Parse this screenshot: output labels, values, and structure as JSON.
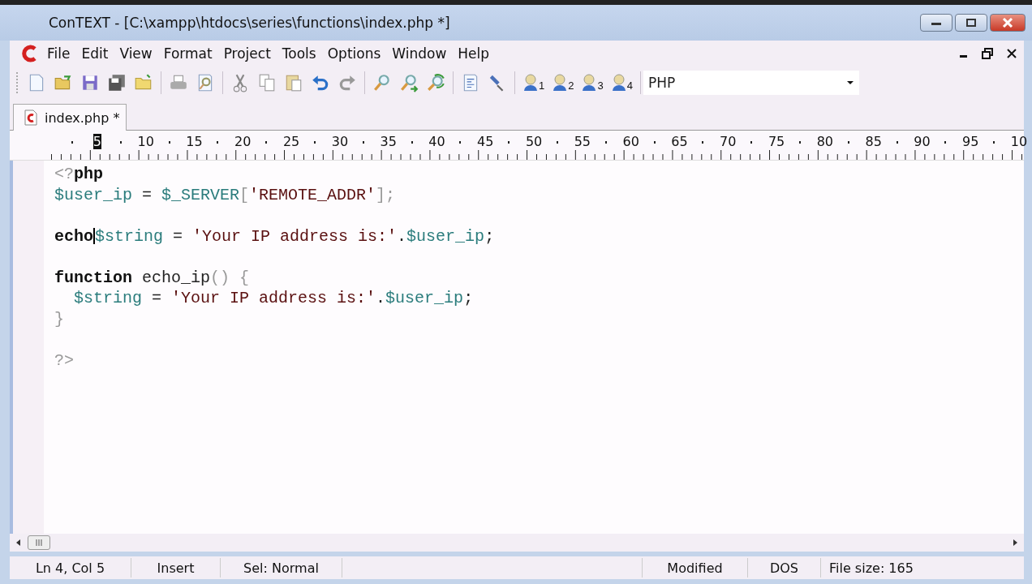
{
  "window": {
    "title": "ConTEXT - [C:\\xampp\\htdocs\\series\\functions\\index.php *]"
  },
  "menu": [
    "File",
    "Edit",
    "View",
    "Format",
    "Project",
    "Tools",
    "Options",
    "Window",
    "Help"
  ],
  "toolbar": {
    "user_slots": [
      "1",
      "2",
      "3",
      "4"
    ],
    "highlighter": "PHP"
  },
  "tabs": [
    {
      "label": "index.php *",
      "selected": true
    }
  ],
  "ruler": [
    {
      "label": "5",
      "selected": true
    },
    {
      "label": "10",
      "selected": false
    },
    {
      "label": "15",
      "selected": false
    },
    {
      "label": "20",
      "selected": false
    },
    {
      "label": "25",
      "selected": false
    },
    {
      "label": "30",
      "selected": false
    },
    {
      "label": "35",
      "selected": false
    },
    {
      "label": "40",
      "selected": false
    },
    {
      "label": "45",
      "selected": false
    },
    {
      "label": "50",
      "selected": false
    },
    {
      "label": "55",
      "selected": false
    },
    {
      "label": "60",
      "selected": false
    },
    {
      "label": "65",
      "selected": false
    },
    {
      "label": "70",
      "selected": false
    },
    {
      "label": "75",
      "selected": false
    },
    {
      "label": "80",
      "selected": false
    },
    {
      "label": "85",
      "selected": false
    },
    {
      "label": "90",
      "selected": false
    },
    {
      "label": "95",
      "selected": false
    },
    {
      "label": "10",
      "selected": false
    }
  ],
  "code": [
    {
      "tokens": [
        {
          "text": "<?",
          "kind": "punct"
        },
        {
          "text": "php",
          "kind": "keyword"
        }
      ]
    },
    {
      "tokens": [
        {
          "text": "$user_ip",
          "kind": "variable"
        },
        {
          "text": " = ",
          "kind": "plain"
        },
        {
          "text": "$_SERVER",
          "kind": "variable"
        },
        {
          "text": "[",
          "kind": "punct"
        },
        {
          "text": "'REMOTE_ADDR'",
          "kind": "string"
        },
        {
          "text": "];",
          "kind": "punct"
        }
      ]
    },
    {
      "tokens": [
        {
          "kind": "blank"
        }
      ]
    },
    {
      "tokens": [
        {
          "text": "echo",
          "kind": "keyword"
        },
        {
          "kind": "caret"
        },
        {
          "text": "$string",
          "kind": "variable"
        },
        {
          "text": " = ",
          "kind": "plain"
        },
        {
          "text": "'Your IP address is:'",
          "kind": "string"
        },
        {
          "text": ".",
          "kind": "plain"
        },
        {
          "text": "$user_ip",
          "kind": "variable"
        },
        {
          "text": ";",
          "kind": "plain"
        }
      ]
    },
    {
      "tokens": [
        {
          "kind": "blank"
        }
      ]
    },
    {
      "tokens": [
        {
          "text": "function",
          "kind": "keyword"
        },
        {
          "text": " echo_ip",
          "kind": "plain"
        },
        {
          "text": "() {",
          "kind": "punct"
        }
      ]
    },
    {
      "tokens": [
        {
          "text": "  $string",
          "kind": "variable"
        },
        {
          "text": " = ",
          "kind": "plain"
        },
        {
          "text": "'Your IP address is:'",
          "kind": "string"
        },
        {
          "text": ".",
          "kind": "plain"
        },
        {
          "text": "$user_ip",
          "kind": "variable"
        },
        {
          "text": ";",
          "kind": "plain"
        }
      ]
    },
    {
      "tokens": [
        {
          "text": "}",
          "kind": "punct"
        }
      ]
    },
    {
      "tokens": [
        {
          "kind": "blank"
        }
      ]
    },
    {
      "tokens": [
        {
          "text": "?>",
          "kind": "punct"
        }
      ]
    }
  ],
  "status_bar": [
    "Ln 4, Col 5",
    "Insert",
    "Sel: Normal",
    "Modified",
    "DOS",
    "File size: 165"
  ]
}
